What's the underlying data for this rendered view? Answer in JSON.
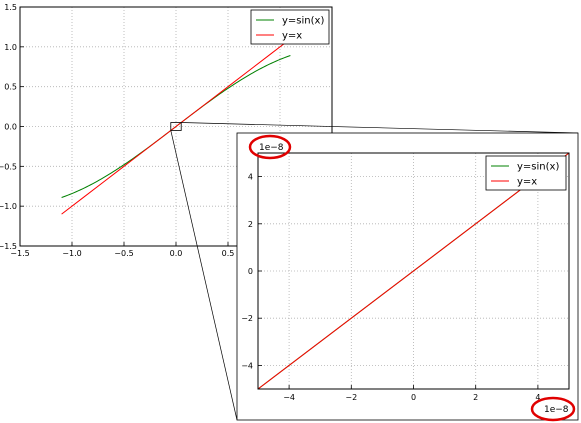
{
  "chart_data": [
    {
      "type": "line",
      "role": "main",
      "xlim": [
        -1.5,
        1.5
      ],
      "ylim": [
        -1.5,
        1.5
      ],
      "grid": true,
      "grid_style": "dotted",
      "legend_placement": "top-right",
      "x_ticks": [
        "−1.5",
        "−1.0",
        "−0.5",
        "0.0",
        "0.5"
      ],
      "y_ticks": [
        "1.5",
        "1.0",
        "0.5",
        "0.0",
        "−0.5",
        "−1.0",
        "−1.5"
      ],
      "x": [
        -1.1,
        -0.9,
        -0.7,
        -0.5,
        -0.3,
        -0.1,
        0.1,
        0.3,
        0.5,
        0.7,
        0.9,
        1.1
      ],
      "series": [
        {
          "name": "y=sin(x)",
          "color": "#008000",
          "values": [
            -0.891,
            -0.783,
            -0.644,
            -0.479,
            -0.296,
            -0.1,
            0.1,
            0.296,
            0.479,
            0.644,
            0.783,
            0.891
          ]
        },
        {
          "name": "y=x",
          "color": "#ff0000",
          "values": [
            -1.1,
            -0.9,
            -0.7,
            -0.5,
            -0.3,
            -0.1,
            0.1,
            0.3,
            0.5,
            0.7,
            0.9,
            1.1
          ]
        }
      ]
    },
    {
      "type": "line",
      "role": "inset-zoom",
      "xlim": [
        -5e-08,
        5e-08
      ],
      "ylim": [
        -5e-08,
        5e-08
      ],
      "grid": true,
      "grid_style": "dotted",
      "legend_placement": "top-right",
      "offset_label_x": "1e−8",
      "offset_label_y": "1e−8",
      "x_ticks": [
        "−4",
        "−2",
        "0",
        "2",
        "4"
      ],
      "y_ticks": [
        "4",
        "2",
        "0",
        "−2",
        "−4"
      ],
      "x": [
        -5e-08,
        5e-08
      ],
      "series": [
        {
          "name": "y=sin(x)",
          "color": "#008000",
          "values": [
            -5e-08,
            5e-08
          ]
        },
        {
          "name": "y=x",
          "color": "#ff0000",
          "values": [
            -5e-08,
            5e-08
          ]
        }
      ]
    }
  ],
  "zoom_region": {
    "xlim": [
      -0.05,
      0.05
    ],
    "ylim": [
      -0.05,
      0.05
    ]
  },
  "highlight_color": "#e00000"
}
